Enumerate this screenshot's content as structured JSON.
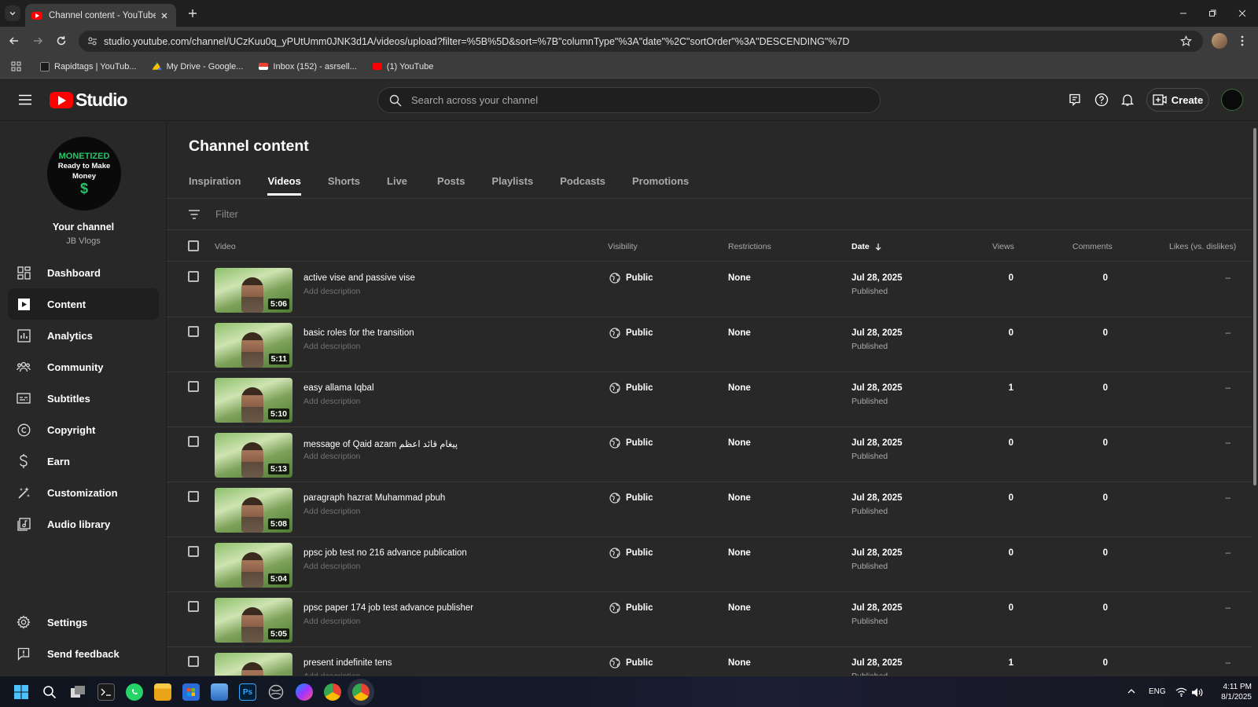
{
  "browser": {
    "tab_title": "Channel content - YouTube Stu",
    "url": "studio.youtube.com/channel/UCzKuu0q_yPUtUmm0JNK3d1A/videos/upload?filter=%5B%5D&sort=%7B\"columnType\"%3A\"date\"%2C\"sortOrder\"%3A\"DESCENDING\"%7D",
    "bookmarks": [
      {
        "label": "Rapidtags | YouTub...",
        "color": "#222222"
      },
      {
        "label": "My Drive - Google...",
        "color": "#fbbc04"
      },
      {
        "label": "Inbox (152) - asrsell...",
        "color": "#ea4335"
      },
      {
        "label": "(1) YouTube",
        "color": "#ff0000"
      }
    ]
  },
  "header": {
    "logo_text": "Studio",
    "search_placeholder": "Search across your channel",
    "create_label": "Create"
  },
  "sidebar": {
    "avatar": {
      "line1": "MONETIZED",
      "line2": "Ready to Make Money",
      "line3": "$"
    },
    "your_channel": "Your channel",
    "channel_name": "JB Vlogs",
    "items": [
      {
        "label": "Dashboard",
        "icon": "dashboard-icon"
      },
      {
        "label": "Content",
        "icon": "content-icon",
        "active": true
      },
      {
        "label": "Analytics",
        "icon": "analytics-icon"
      },
      {
        "label": "Community",
        "icon": "community-icon"
      },
      {
        "label": "Subtitles",
        "icon": "subtitles-icon"
      },
      {
        "label": "Copyright",
        "icon": "copyright-icon"
      },
      {
        "label": "Earn",
        "icon": "earn-icon"
      },
      {
        "label": "Customization",
        "icon": "customization-icon"
      },
      {
        "label": "Audio library",
        "icon": "audio-library-icon"
      }
    ],
    "bottom_items": [
      {
        "label": "Settings",
        "icon": "settings-icon"
      },
      {
        "label": "Send feedback",
        "icon": "feedback-icon"
      }
    ]
  },
  "main": {
    "title": "Channel content",
    "tabs": [
      "Inspiration",
      "Videos",
      "Shorts",
      "Live",
      "Posts",
      "Playlists",
      "Podcasts",
      "Promotions"
    ],
    "active_tab": "Videos",
    "filter_placeholder": "Filter",
    "columns": {
      "video": "Video",
      "visibility": "Visibility",
      "restrictions": "Restrictions",
      "date": "Date",
      "views": "Views",
      "comments": "Comments",
      "likes": "Likes (vs. dislikes)"
    },
    "rows": [
      {
        "title": "active vise and passive vise",
        "description": "Add description",
        "duration": "5:06",
        "visibility": "Public",
        "restrictions": "None",
        "date": "Jul 28, 2025",
        "status": "Published",
        "views": "0",
        "comments": "0",
        "likes": "–"
      },
      {
        "title": "basic roles for the transition",
        "description": "Add description",
        "duration": "5:11",
        "visibility": "Public",
        "restrictions": "None",
        "date": "Jul 28, 2025",
        "status": "Published",
        "views": "0",
        "comments": "0",
        "likes": "–"
      },
      {
        "title": "easy allama Iqbal",
        "description": "Add description",
        "duration": "5:10",
        "visibility": "Public",
        "restrictions": "None",
        "date": "Jul 28, 2025",
        "status": "Published",
        "views": "1",
        "comments": "0",
        "likes": "–"
      },
      {
        "title": "message of Qaid azam پیغام قائد اعظم",
        "description": "Add description",
        "duration": "5:13",
        "visibility": "Public",
        "restrictions": "None",
        "date": "Jul 28, 2025",
        "status": "Published",
        "views": "0",
        "comments": "0",
        "likes": "–"
      },
      {
        "title": "paragraph hazrat Muhammad pbuh",
        "description": "Add description",
        "duration": "5:08",
        "visibility": "Public",
        "restrictions": "None",
        "date": "Jul 28, 2025",
        "status": "Published",
        "views": "0",
        "comments": "0",
        "likes": "–"
      },
      {
        "title": "ppsc job test no 216 advance publication",
        "description": "Add description",
        "duration": "5:04",
        "visibility": "Public",
        "restrictions": "None",
        "date": "Jul 28, 2025",
        "status": "Published",
        "views": "0",
        "comments": "0",
        "likes": "–"
      },
      {
        "title": "ppsc paper 174 job test advance publisher",
        "description": "Add description",
        "duration": "5:05",
        "visibility": "Public",
        "restrictions": "None",
        "date": "Jul 28, 2025",
        "status": "Published",
        "views": "0",
        "comments": "0",
        "likes": "–"
      },
      {
        "title": "present indefinite tens",
        "description": "Add description",
        "duration": "",
        "visibility": "Public",
        "restrictions": "None",
        "date": "Jul 28, 2025",
        "status": "Published",
        "views": "1",
        "comments": "0",
        "likes": "–"
      }
    ]
  },
  "taskbar": {
    "language": "ENG",
    "time": "4:11 PM",
    "date": "8/1/2025"
  }
}
